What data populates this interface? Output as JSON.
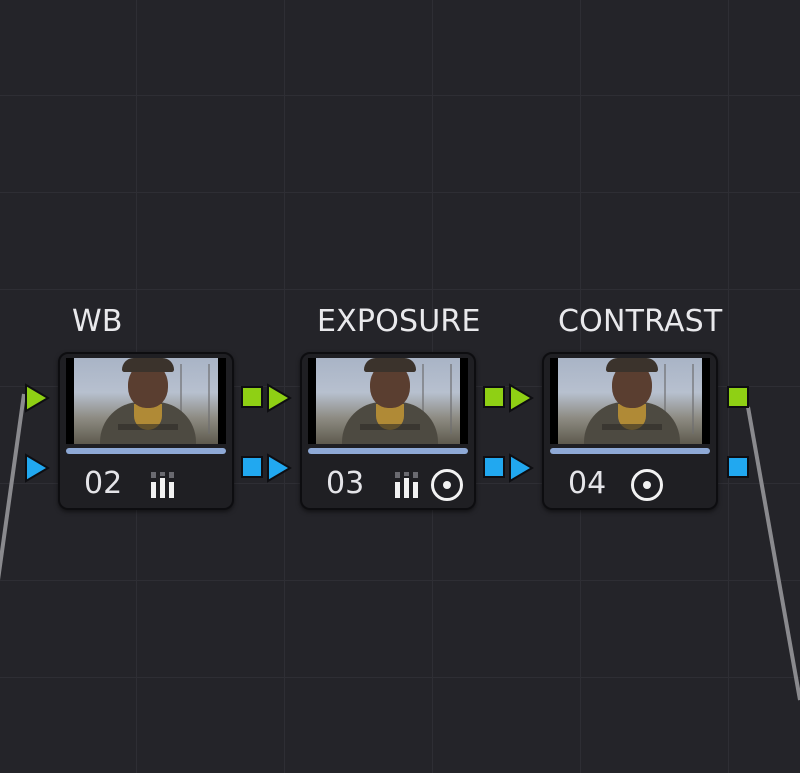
{
  "colors": {
    "background": "#242429",
    "node_body": "#1f1f23",
    "label_text": "#e9e9ec",
    "rgb_port": "#8fd014",
    "alpha_port": "#21a8f0",
    "progress_bar": "#8ea9d6",
    "link_line": "#8a8a8e"
  },
  "nodes": [
    {
      "label": "WB",
      "number": "02",
      "icons": [
        "bars-icon"
      ]
    },
    {
      "label": "EXPOSURE",
      "number": "03",
      "icons": [
        "bars-icon",
        "target-icon"
      ]
    },
    {
      "label": "CONTRAST",
      "number": "04",
      "icons": [
        "target-icon"
      ]
    }
  ]
}
